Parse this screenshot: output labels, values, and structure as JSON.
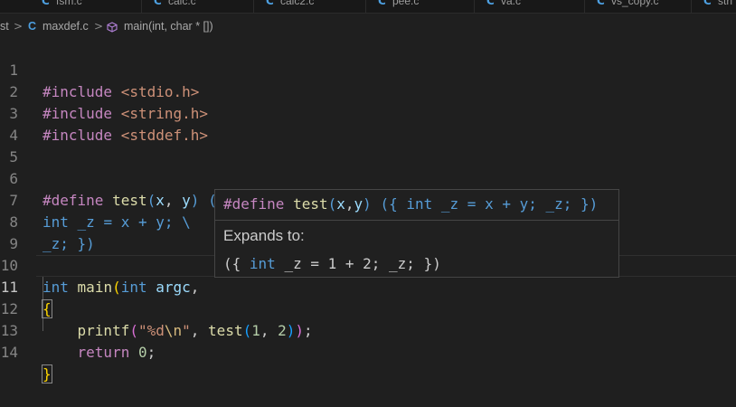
{
  "tabs": [
    {
      "icon": "C",
      "label": "fsm.c"
    },
    {
      "icon": "C",
      "label": "calc.c"
    },
    {
      "icon": "C",
      "label": "calc2.c"
    },
    {
      "icon": "C",
      "label": "pee.c"
    },
    {
      "icon": "C",
      "label": "va.c"
    },
    {
      "icon": "C",
      "label": "vs_copy.c"
    },
    {
      "icon": "C",
      "label": "stri"
    }
  ],
  "breadcrumb": {
    "folder": "st",
    "file_icon": "C",
    "file": "maxdef.c",
    "symbol_icon": "cube-icon",
    "symbol": "main(int, char * [])",
    "separator": ">"
  },
  "editor": {
    "active_line": 11,
    "lines": [
      {
        "n": "1"
      },
      {
        "n": "2"
      },
      {
        "n": "3"
      },
      {
        "n": "4"
      },
      {
        "n": "5"
      },
      {
        "n": "6"
      },
      {
        "n": "7"
      },
      {
        "n": "8"
      },
      {
        "n": "9"
      },
      {
        "n": "10"
      },
      {
        "n": "11"
      },
      {
        "n": "12"
      },
      {
        "n": "13"
      },
      {
        "n": "14"
      }
    ],
    "tokens": {
      "l1_dir": "#include",
      "l1_hdr": "<stdio.h>",
      "l2_dir": "#include",
      "l2_hdr": "<string.h>",
      "l3_dir": "#include",
      "l3_hdr": "<stddef.h>",
      "l6_dir": "#define",
      "l6_name": "test",
      "l6_p1": "x",
      "l6_p2": "y",
      "l6_rest": "({ \\",
      "l7_kw": "int",
      "l7_rest": " _z = x + y; \\",
      "l8_text": "_z; })",
      "l10_kw1": "int",
      "l10_fn": "main",
      "l10_kw2": "int",
      "l10_var": "argc",
      "l10_tail": ",",
      "l11_brace": "{",
      "l12_fn": "printf",
      "l12_str1": "\"%d",
      "l12_esc": "\\n",
      "l12_str2": "\"",
      "l12_macro": "test",
      "l12_n1": "1",
      "l12_n2": "2",
      "l13_kw": "return",
      "l13_num": "0",
      "l14_brace": "}"
    }
  },
  "hover": {
    "sig_dir": "#define",
    "sig_name": "test",
    "sig_p1": "x",
    "sig_p2": "y",
    "sig_kw": "int",
    "sig_body_a": "({ ",
    "sig_body_b": " _z = x + y; _z; })",
    "label": "Expands to:",
    "exp_a": "({ ",
    "exp_kw": "int",
    "exp_b": " _z = 1 + 2; _z; })"
  }
}
